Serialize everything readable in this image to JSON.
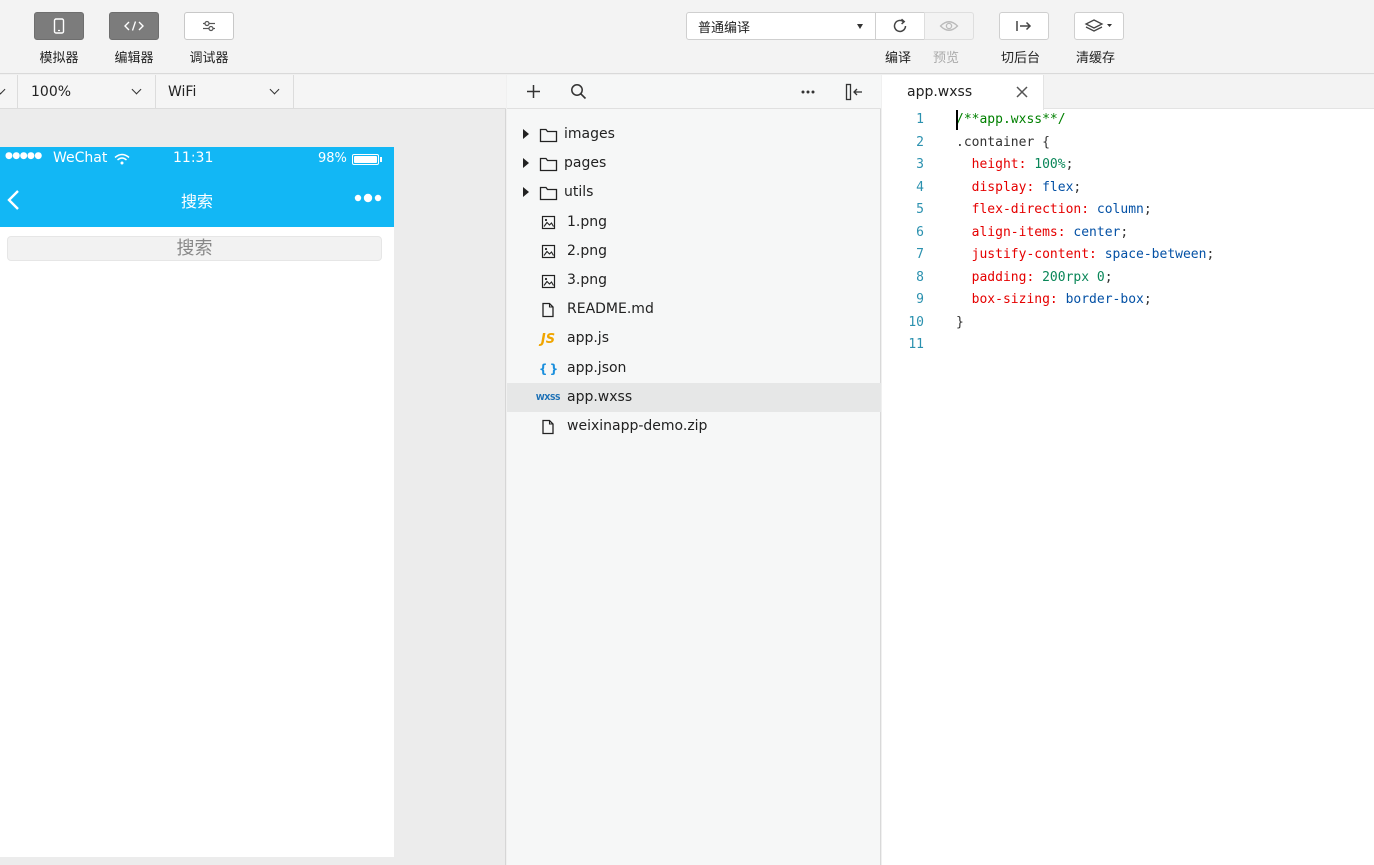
{
  "toolbar": {
    "simulator_label": "模拟器",
    "editor_label": "编辑器",
    "debugger_label": "调试器",
    "compile_mode": "普通编译",
    "compile_label": "编译",
    "preview_label": "预览",
    "background_label": "切后台",
    "clear_cache_label": "清缓存"
  },
  "simulator": {
    "zoom": "100%",
    "network": "WiFi",
    "status": {
      "signal": "●●●●●",
      "carrier": "WeChat",
      "time": "11:31",
      "battery": "98%",
      "battery_level": 0.98
    },
    "nav_title": "搜索",
    "search_placeholder": "搜索"
  },
  "filetree": {
    "items": [
      {
        "name": "images",
        "type": "folder"
      },
      {
        "name": "pages",
        "type": "folder"
      },
      {
        "name": "utils",
        "type": "folder"
      },
      {
        "name": "1.png",
        "type": "image"
      },
      {
        "name": "2.png",
        "type": "image"
      },
      {
        "name": "3.png",
        "type": "image"
      },
      {
        "name": "README.md",
        "type": "file"
      },
      {
        "name": "app.js",
        "type": "js",
        "badge": "JS"
      },
      {
        "name": "app.json",
        "type": "json",
        "badge": "{ }"
      },
      {
        "name": "app.wxss",
        "type": "wxss",
        "badge": "WXSS",
        "selected": true
      },
      {
        "name": "weixinapp-demo.zip",
        "type": "file"
      }
    ]
  },
  "editor": {
    "tab_name": "app.wxss",
    "lines": [
      {
        "n": "1",
        "t": [
          [
            "c-com",
            "/**app.wxss**/"
          ]
        ]
      },
      {
        "n": "2",
        "t": [
          [
            "c-sel",
            ".container "
          ],
          [
            "c-pun",
            "{"
          ]
        ]
      },
      {
        "n": "3",
        "t": [
          [
            "c-prop",
            "  height: "
          ],
          [
            "c-num",
            "100%"
          ],
          [
            "c-pun",
            ";"
          ]
        ]
      },
      {
        "n": "4",
        "t": [
          [
            "c-prop",
            "  display: "
          ],
          [
            "c-val",
            "flex"
          ],
          [
            "c-pun",
            ";"
          ]
        ]
      },
      {
        "n": "5",
        "t": [
          [
            "c-prop",
            "  flex-direction: "
          ],
          [
            "c-val",
            "column"
          ],
          [
            "c-pun",
            ";"
          ]
        ]
      },
      {
        "n": "6",
        "t": [
          [
            "c-prop",
            "  align-items: "
          ],
          [
            "c-val",
            "center"
          ],
          [
            "c-pun",
            ";"
          ]
        ]
      },
      {
        "n": "7",
        "t": [
          [
            "c-prop",
            "  justify-content: "
          ],
          [
            "c-val",
            "space-between"
          ],
          [
            "c-pun",
            ";"
          ]
        ]
      },
      {
        "n": "8",
        "t": [
          [
            "c-prop",
            "  padding: "
          ],
          [
            "c-num",
            "200rpx 0"
          ],
          [
            "c-pun",
            ";"
          ]
        ]
      },
      {
        "n": "9",
        "t": [
          [
            "c-prop",
            "  box-sizing: "
          ],
          [
            "c-val",
            "border-box"
          ],
          [
            "c-pun",
            ";"
          ]
        ]
      },
      {
        "n": "10",
        "t": [
          [
            "c-pun",
            "}"
          ]
        ]
      },
      {
        "n": "11",
        "t": []
      }
    ]
  },
  "colors": {
    "accent": "#12b7f5"
  }
}
